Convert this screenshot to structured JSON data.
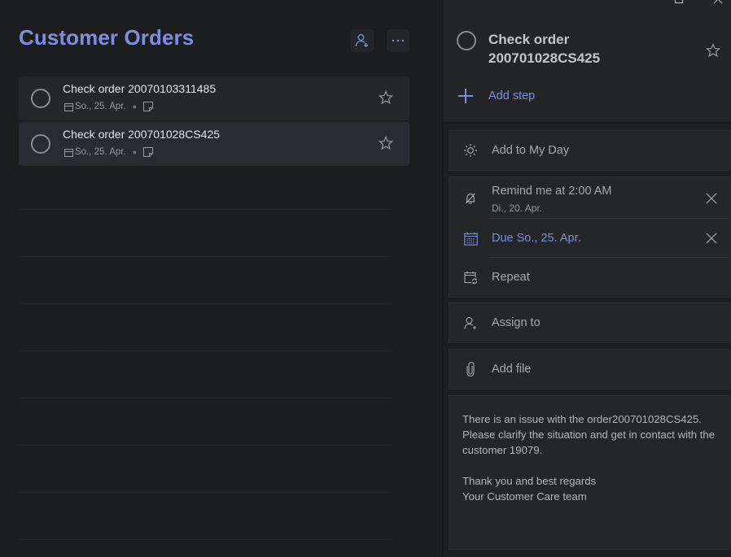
{
  "list": {
    "title": "Customer Orders",
    "share_button": "share-list",
    "more_button": "more-options",
    "accent_color": "#7b8fe0",
    "tasks": [
      {
        "title": "Check order 20070103311485",
        "due": "So., 25. Apr.",
        "has_note": true,
        "starred": false,
        "completed": false
      },
      {
        "title": "Check order 200701028CS425",
        "due": "So., 25. Apr.",
        "has_note": true,
        "starred": false,
        "completed": false,
        "selected": true
      }
    ]
  },
  "detail": {
    "title_line1": "Check order",
    "title_line2": "200701028CS425",
    "add_step": "Add step",
    "add_to_my_day": "Add to My Day",
    "reminder": {
      "label": "Remind me at 2:00 AM",
      "date": "Di., 20. Apr."
    },
    "due": "Due So., 25. Apr.",
    "repeat": "Repeat",
    "assign_to": "Assign to",
    "add_file": "Add file",
    "note": "There is an issue with the order200701028CS425.\nPlease clarify the situation and get in contact with the customer 19079.\n\nThank you and best regards\nYour Customer Care team"
  },
  "icons": {
    "share": "person-add-icon",
    "more": "ellipsis-icon",
    "checkbox": "circle-icon",
    "star": "star-outline-icon",
    "calendar": "calendar-icon",
    "note": "note-icon",
    "sun": "sun-icon",
    "reminder": "bell-off-icon",
    "due": "calendar-grid-icon",
    "repeat": "calendar-repeat-icon",
    "assign": "person-add-icon",
    "attach": "paperclip-icon",
    "remove": "close-icon"
  }
}
